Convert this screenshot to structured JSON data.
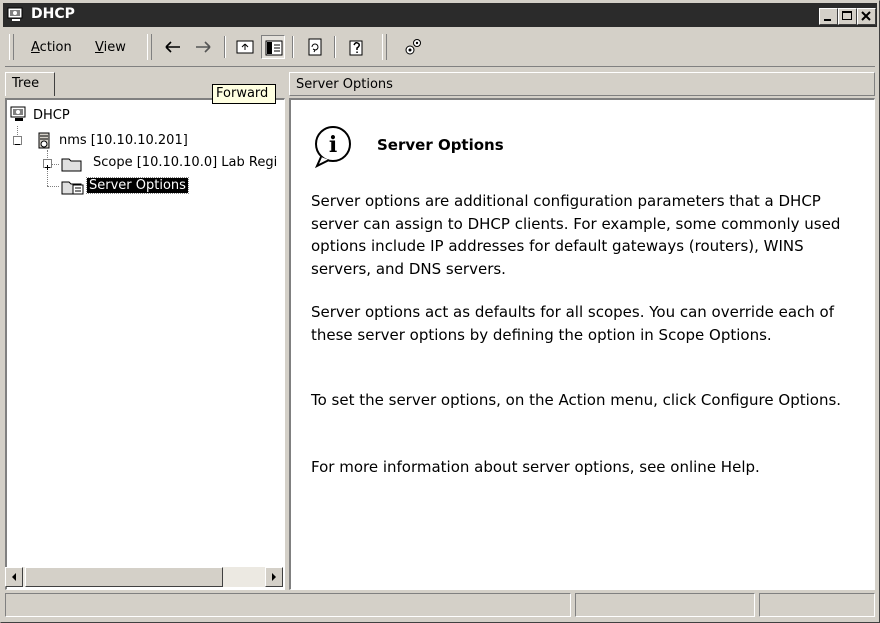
{
  "window": {
    "title": "DHCP"
  },
  "toolbar": {
    "menu_action": "Action",
    "menu_view": "View"
  },
  "tooltip": {
    "text": "Forward"
  },
  "tree": {
    "tab_label": "Tree",
    "root": "DHCP",
    "server": "nms [10.10.10.201]",
    "scope": "Scope [10.10.10.0] Lab Regi",
    "server_options": "Server Options"
  },
  "content": {
    "header": "Server Options",
    "title": "Server Options",
    "paragraphs": [
      "Server options are additional configuration parameters that a DHCP server can assign to DHCP clients. For example, some commonly used options include IP addresses for default gateways (routers), WINS servers, and DNS servers.",
      "Server options act as defaults for all scopes.  You can override each of these server options by defining the option in Scope Options.",
      "To set the server options, on the Action menu, click Configure Options.",
      "For more information about server options, see online Help."
    ]
  },
  "colors": {
    "titlebar": "#2b2b2b",
    "face": "#d4d0c8",
    "tooltip": "#ffffe1"
  }
}
